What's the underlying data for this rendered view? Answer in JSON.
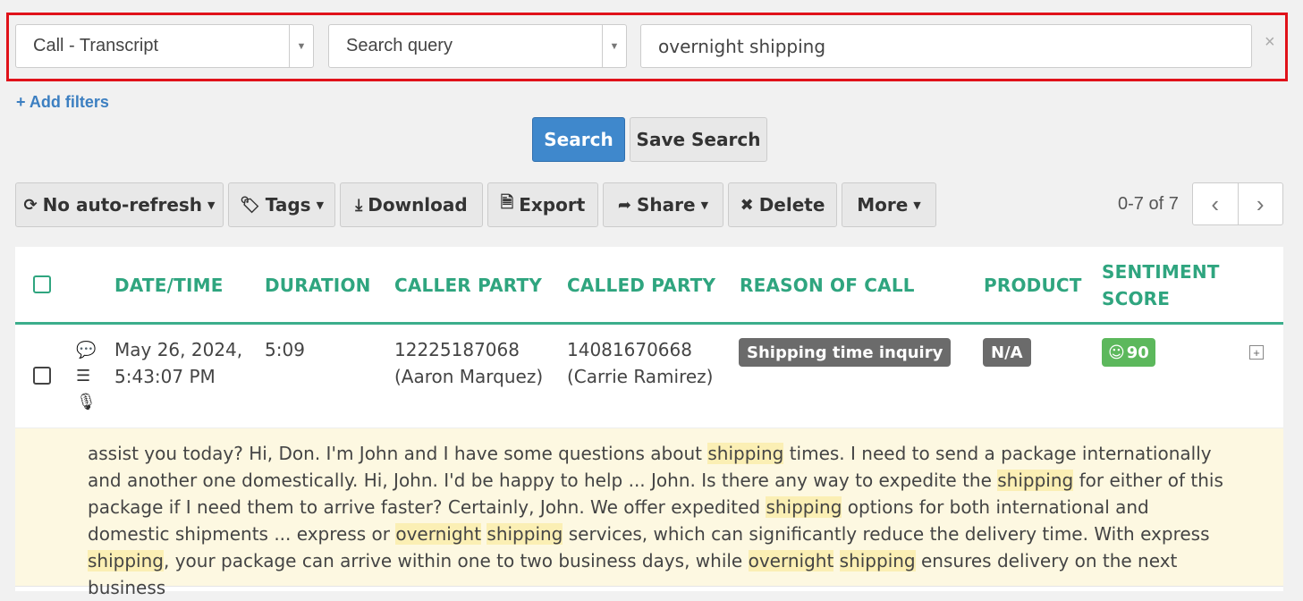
{
  "filters": {
    "field": "Call - Transcript",
    "operator": "Search query",
    "value": "overnight shipping",
    "clear": "×",
    "add_filters": "Add filters",
    "add_icon": "+"
  },
  "actions": {
    "search": "Search",
    "save_search": "Save Search"
  },
  "toolbar": {
    "auto_refresh": "No auto-refresh",
    "tags": "Tags",
    "download": "Download",
    "export": "Export",
    "share": "Share",
    "delete": "Delete",
    "more": "More"
  },
  "pagination": {
    "range": "0-7 of 7",
    "prev": "‹",
    "next": "›"
  },
  "table": {
    "columns": {
      "datetime": "DATE/TIME",
      "duration": "DURATION",
      "caller": "CALLER PARTY",
      "called": "CALLED PARTY",
      "reason": "REASON OF CALL",
      "product": "PRODUCT",
      "sentiment_1": "SENTIMENT",
      "sentiment_2": "SCORE"
    },
    "rows": [
      {
        "date": "May 26, 2024,",
        "time": "5:43:07 PM",
        "duration": "5:09",
        "caller_number": "12225187068",
        "caller_name": "(Aaron Marquez)",
        "called_number": "14081670668",
        "called_name": "(Carrie Ramirez)",
        "reason": "Shipping time inquiry",
        "product": "N/A",
        "sentiment": "90",
        "sentiment_icon": "☺"
      }
    ]
  },
  "transcript": {
    "t1": "assist you today? Hi, Don. I'm John and I have some questions about ",
    "h1": "shipping",
    "t2": " times. I need to send a package internationally and another one domestically. Hi, John. I'd be happy to help ... John. Is there any way to expedite the ",
    "h2": "shipping",
    "t3": " for either of this package if I need them to arrive faster? Certainly, John. We offer expedited ",
    "h3": "shipping",
    "t4": " options for both international and domestic shipments ... express or ",
    "h4": "overnight",
    "t5": " ",
    "h5": "shipping",
    "t6": " services, which can significantly reduce the delivery time. With express ",
    "h6": "shipping",
    "t7": ", your package can arrive within one to two business days, while ",
    "h7": "overnight",
    "t8": " ",
    "h8": "shipping",
    "t9": " ensures delivery on the next business"
  },
  "colors": {
    "primary": "#3f88cc",
    "header_green": "#2fa57f",
    "highlight": "#fbefb4",
    "filter_border": "#e0121a",
    "sentiment_green": "#5cb85c",
    "badge_gray": "#6b6b6b"
  }
}
